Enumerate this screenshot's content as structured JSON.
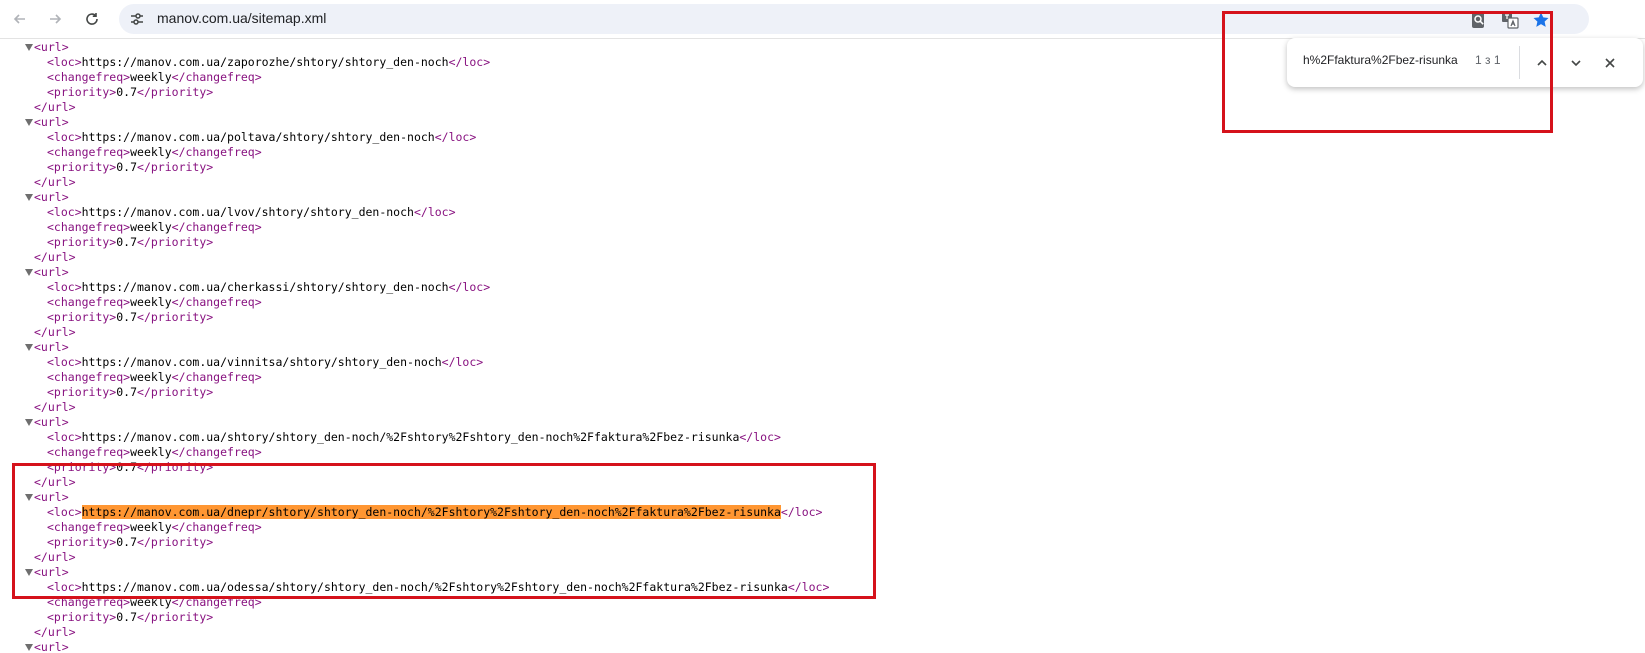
{
  "browser": {
    "url": "manov.com.ua/sitemap.xml",
    "icons": {
      "back": "back-arrow-icon",
      "forward": "forward-arrow-icon",
      "reload": "reload-icon",
      "site_info": "tune-icon",
      "page_search": "page-search-icon",
      "translate": "translate-icon",
      "bookmark": "star-icon"
    }
  },
  "find_bar": {
    "query": "h%2Ffaktura%2Fbez-risunka",
    "count": "1 з 1"
  },
  "xml": {
    "tags": {
      "url_open": "<url>",
      "url_close": "</url>",
      "loc_open": "<loc>",
      "loc_close": "</loc>",
      "changefreq_open": "<changefreq>",
      "changefreq_close": "</changefreq>",
      "priority_open": "<priority>",
      "priority_close": "</priority>"
    },
    "entries": [
      {
        "loc": "https://manov.com.ua/zaporozhe/shtory/shtory_den-noch",
        "changefreq": "weekly",
        "priority": "0.7"
      },
      {
        "loc": "https://manov.com.ua/poltava/shtory/shtory_den-noch",
        "changefreq": "weekly",
        "priority": "0.7"
      },
      {
        "loc": "https://manov.com.ua/lvov/shtory/shtory_den-noch",
        "changefreq": "weekly",
        "priority": "0.7"
      },
      {
        "loc": "https://manov.com.ua/cherkassi/shtory/shtory_den-noch",
        "changefreq": "weekly",
        "priority": "0.7"
      },
      {
        "loc": "https://manov.com.ua/vinnitsa/shtory/shtory_den-noch",
        "changefreq": "weekly",
        "priority": "0.7"
      },
      {
        "loc": "https://manov.com.ua/shtory/shtory_den-noch/%2Fshtory%2Fshtory_den-noch%2Ffaktura%2Fbez-risunka",
        "changefreq": "weekly",
        "priority": "0.7"
      },
      {
        "loc": "https://manov.com.ua/dnepr/shtory/shtory_den-noch/%2Fshtory%2Fshtory_den-noch%2Ffaktura%2Fbez-risunka",
        "changefreq": "weekly",
        "priority": "0.7",
        "highlighted": true
      },
      {
        "loc": "https://manov.com.ua/odessa/shtory/shtory_den-noch/%2Fshtory%2Fshtory_den-noch%2Ffaktura%2Fbez-risunka",
        "changefreq": "weekly",
        "priority": "0.7"
      }
    ]
  },
  "colors": {
    "tag": "#881280",
    "find_highlight": "#ff9632",
    "annotation_box": "#d5121b",
    "bookmark_star": "#1a73e8"
  }
}
